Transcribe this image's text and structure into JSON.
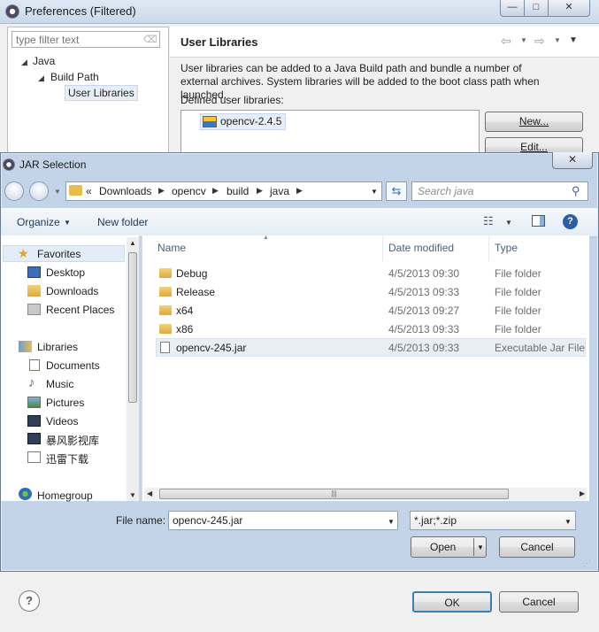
{
  "preferences": {
    "title": "Preferences (Filtered)",
    "window_controls": {
      "minimize": "—",
      "maximize": "□",
      "close": "✕"
    },
    "filter_placeholder": "type filter text",
    "tree": {
      "java": "Java",
      "build_path": "Build Path",
      "user_libraries": "User Libraries"
    },
    "page": {
      "heading": "User Libraries",
      "description": "User libraries can be added to a Java Build path and bundle a number of external archives. System libraries will be added to the boot class path when launched.",
      "defined_label": "Defined user libraries:",
      "libraries": [
        "opencv-2.4.5"
      ],
      "buttons": {
        "new": "New...",
        "edit": "Edit..."
      }
    },
    "bottom": {
      "ok": "OK",
      "cancel": "Cancel",
      "help_glyph": "?"
    }
  },
  "jar_dialog": {
    "title": "JAR Selection",
    "close_glyph": "✕",
    "address": {
      "overflow": "«",
      "crumbs": [
        "Downloads",
        "opencv",
        "build",
        "java"
      ]
    },
    "search_placeholder": "Search java",
    "toolbar": {
      "organize": "Organize",
      "new_folder": "New folder",
      "help_glyph": "?"
    },
    "nav": {
      "favorites": "Favorites",
      "desktop": "Desktop",
      "downloads": "Downloads",
      "recent_places": "Recent Places",
      "libraries": "Libraries",
      "documents": "Documents",
      "music": "Music",
      "pictures": "Pictures",
      "videos": "Videos",
      "storm_video": "暴风影视库",
      "thunder_downloads": "迅雷下载",
      "homegroup": "Homegroup"
    },
    "columns": {
      "name": "Name",
      "date": "Date modified",
      "type": "Type"
    },
    "files": [
      {
        "name": "Debug",
        "date": "4/5/2013 09:30",
        "type": "File folder"
      },
      {
        "name": "Release",
        "date": "4/5/2013 09:33",
        "type": "File folder"
      },
      {
        "name": "x64",
        "date": "4/5/2013 09:27",
        "type": "File folder"
      },
      {
        "name": "x86",
        "date": "4/5/2013 09:33",
        "type": "File folder"
      },
      {
        "name": "opencv-245.jar",
        "date": "4/5/2013 09:33",
        "type": "Executable Jar File"
      }
    ],
    "file_name_label": "File name:",
    "file_name_value": "opencv-245.jar",
    "file_type_filter": "*.jar;*.zip",
    "open": "Open",
    "cancel": "Cancel"
  },
  "colors": {
    "title_gradient_top": "#dfe9f5",
    "selection": "#e8eef4",
    "link_blue": "#1e395b"
  }
}
